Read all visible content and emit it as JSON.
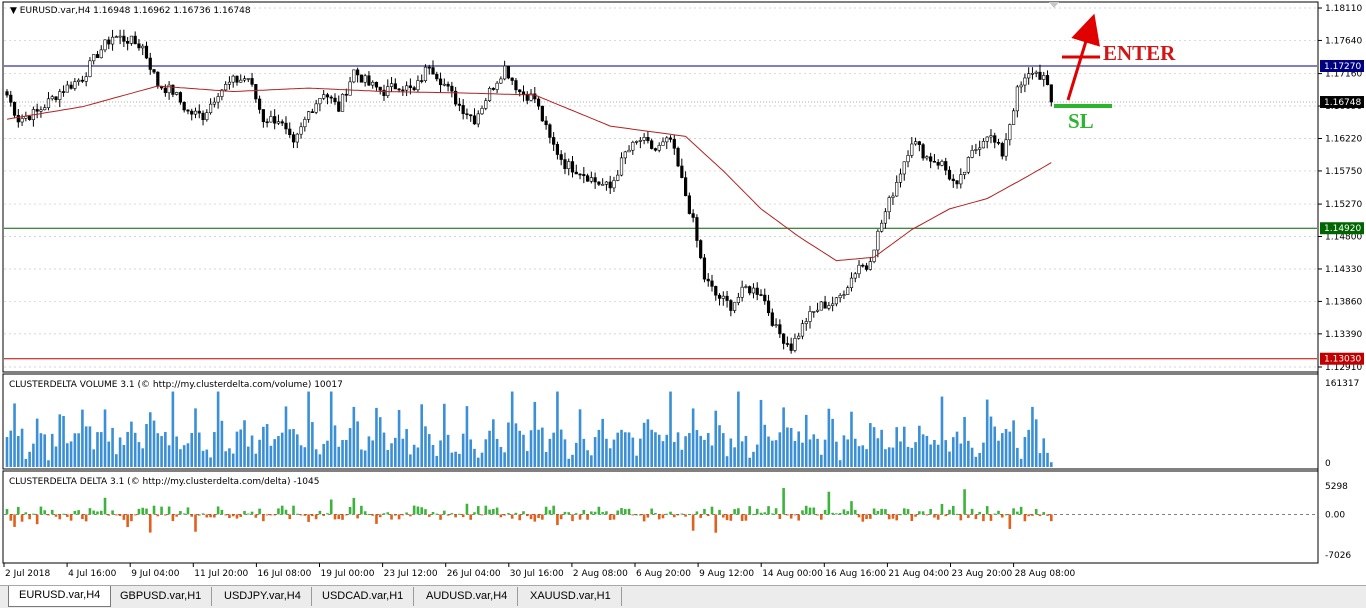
{
  "symbol_header": "EURUSD.var,H4  1.16948 1.16962 1.16736 1.16748",
  "annotations": {
    "enter": "ENTER",
    "sl": "SL"
  },
  "colors": {
    "bull": "#000000",
    "bear": "#000000",
    "ma": "#b22222",
    "hline_top": "#000080",
    "hline_mid": "#006400",
    "hline_low": "#c00000",
    "enter": "#e00000",
    "sl": "#2cb52c",
    "volume": "#3a8fd6",
    "delta_pos": "#3cb43c",
    "delta_neg": "#e0601c"
  },
  "chart_data": [
    {
      "type": "candlestick",
      "panel": "main",
      "title": "EURUSD.var,H4",
      "ylim": [
        1.1291,
        1.1811
      ],
      "y_ticks": [
        "1.18110",
        "1.17640",
        "1.17160",
        "1.16690",
        "1.16220",
        "1.15750",
        "1.15270",
        "1.14800",
        "1.14330",
        "1.13860",
        "1.13390",
        "1.12910"
      ],
      "price_labels": {
        "line_top": "1.17270",
        "current": "1.16748",
        "line_mid": "1.14920",
        "line_low": "1.13030"
      },
      "x_ticks": [
        "2 Jul 2018",
        "4 Jul 16:00",
        "9 Jul 04:00",
        "11 Jul 20:00",
        "16 Jul 08:00",
        "19 Jul 00:00",
        "23 Jul 12:00",
        "26 Jul 04:00",
        "30 Jul 16:00",
        "2 Aug 08:00",
        "6 Aug 20:00",
        "9 Aug 12:00",
        "14 Aug 00:00",
        "16 Aug 16:00",
        "21 Aug 04:00",
        "23 Aug 20:00",
        "28 Aug 08:00"
      ],
      "anchors": [
        [
          0,
          1.1685
        ],
        [
          3,
          1.165
        ],
        [
          8,
          1.166
        ],
        [
          14,
          1.169
        ],
        [
          20,
          1.171
        ],
        [
          24,
          1.1745
        ],
        [
          28,
          1.177
        ],
        [
          32,
          1.1765
        ],
        [
          36,
          1.1755
        ],
        [
          40,
          1.17
        ],
        [
          44,
          1.169
        ],
        [
          48,
          1.166
        ],
        [
          52,
          1.1655
        ],
        [
          56,
          1.169
        ],
        [
          60,
          1.1705
        ],
        [
          64,
          1.171
        ],
        [
          68,
          1.165
        ],
        [
          72,
          1.165
        ],
        [
          76,
          1.161
        ],
        [
          80,
          1.166
        ],
        [
          84,
          1.169
        ],
        [
          88,
          1.1665
        ],
        [
          92,
          1.172
        ],
        [
          96,
          1.17
        ],
        [
          100,
          1.169
        ],
        [
          104,
          1.17
        ],
        [
          108,
          1.169
        ],
        [
          112,
          1.173
        ],
        [
          116,
          1.17
        ],
        [
          120,
          1.167
        ],
        [
          124,
          1.165
        ],
        [
          128,
          1.169
        ],
        [
          132,
          1.1725
        ],
        [
          136,
          1.169
        ],
        [
          140,
          1.168
        ],
        [
          144,
          1.162
        ],
        [
          148,
          1.1585
        ],
        [
          152,
          1.1575
        ],
        [
          156,
          1.156
        ],
        [
          160,
          1.155
        ],
        [
          164,
          1.16
        ],
        [
          168,
          1.162
        ],
        [
          172,
          1.1605
        ],
        [
          176,
          1.162
        ],
        [
          178,
          1.158
        ],
        [
          182,
          1.15
        ],
        [
          185,
          1.142
        ],
        [
          188,
          1.1395
        ],
        [
          192,
          1.138
        ],
        [
          196,
          1.1405
        ],
        [
          200,
          1.14
        ],
        [
          204,
          1.1345
        ],
        [
          208,
          1.132
        ],
        [
          212,
          1.136
        ],
        [
          216,
          1.138
        ],
        [
          220,
          1.1385
        ],
        [
          224,
          1.142
        ],
        [
          226,
          1.144
        ],
        [
          228,
          1.1435
        ],
        [
          232,
          1.15
        ],
        [
          236,
          1.156
        ],
        [
          240,
          1.162
        ],
        [
          244,
          1.1595
        ],
        [
          248,
          1.1585
        ],
        [
          252,
          1.155
        ],
        [
          256,
          1.16
        ],
        [
          260,
          1.163
        ],
        [
          264,
          1.16
        ],
        [
          268,
          1.169
        ],
        [
          270,
          1.1705
        ],
        [
          272,
          1.172
        ],
        [
          275,
          1.171
        ],
        [
          277,
          1.1675
        ]
      ],
      "ma_points": [
        [
          0,
          1.165
        ],
        [
          20,
          1.1668
        ],
        [
          40,
          1.1698
        ],
        [
          60,
          1.169
        ],
        [
          80,
          1.1695
        ],
        [
          100,
          1.169
        ],
        [
          120,
          1.1688
        ],
        [
          140,
          1.1685
        ],
        [
          160,
          1.164
        ],
        [
          180,
          1.1625
        ],
        [
          190,
          1.1575
        ],
        [
          200,
          1.152
        ],
        [
          210,
          1.148
        ],
        [
          220,
          1.1445
        ],
        [
          230,
          1.145
        ],
        [
          240,
          1.149
        ],
        [
          250,
          1.152
        ],
        [
          260,
          1.1535
        ],
        [
          270,
          1.1565
        ],
        [
          277,
          1.1587
        ]
      ],
      "hlines": [
        1.1727,
        1.1492,
        1.1303
      ],
      "current_price": 1.16748
    },
    {
      "type": "bar",
      "panel": "volume",
      "title": "CLUSTERDELTA VOLUME 3.1 (© http://my.clusterdelta.com/volume) 10017",
      "ylim": [
        0,
        161317
      ],
      "y_ticks": [
        "161317",
        "0"
      ],
      "last_value": 10017
    },
    {
      "type": "bar",
      "panel": "delta",
      "title": "CLUSTERDELTA DELTA 3.1 (© http://my.clusterdelta.com/delta) -1045",
      "ylim": [
        -7026,
        5298
      ],
      "y_ticks": [
        "5298",
        "0.00",
        "-7026"
      ],
      "last_value": -1045
    }
  ],
  "tabs": [
    "EURUSD.var,H4",
    "GBPUSD.var,H1",
    "USDJPY.var,H4",
    "USDCAD.var,H1",
    "AUDUSD.var,H4",
    "XAUUSD.var,H1"
  ]
}
